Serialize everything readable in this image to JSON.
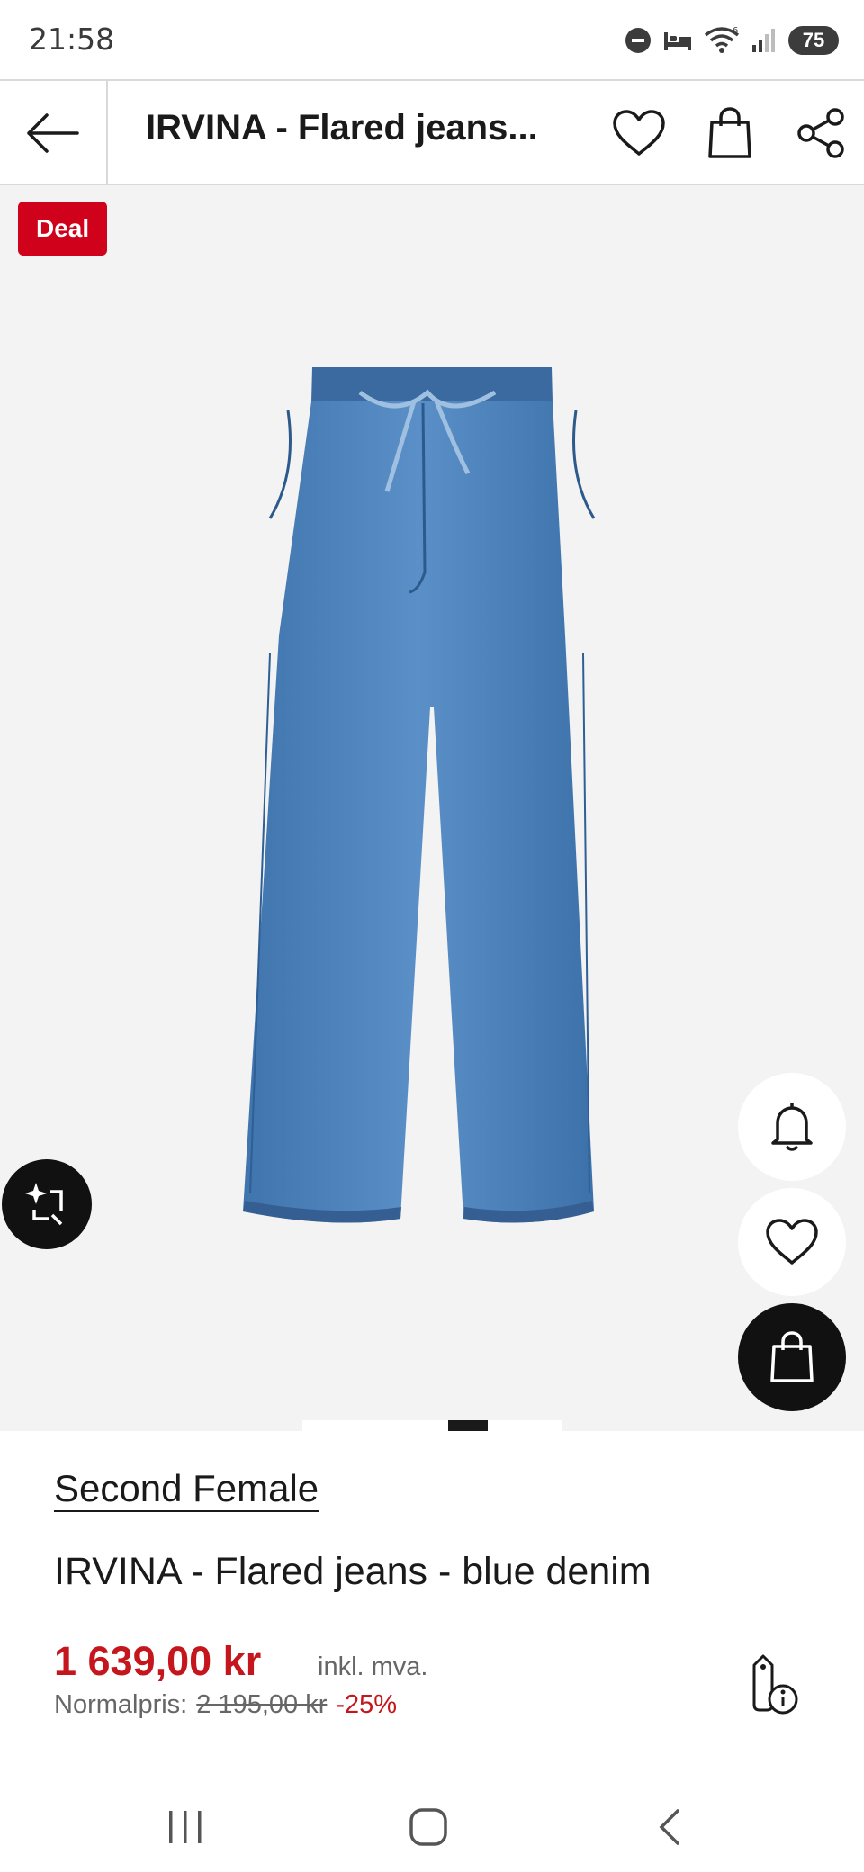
{
  "status_bar": {
    "time": "21:58",
    "battery": "75",
    "wifi_badge": "6"
  },
  "header": {
    "title": "IRVINA - Flared jeans..."
  },
  "gallery": {
    "badge": "Deal",
    "image_alt": "blue denim flared jeans",
    "pager_count": 5,
    "pager_active": 1
  },
  "product": {
    "brand": "Second Female",
    "name": "IRVINA - Flared jeans - blue denim",
    "price": "1 639,00 kr",
    "price_note": "inkl. mva.",
    "normal_label": "Normalpris:",
    "normal_price": "2 195,00 kr",
    "discount": "-25%"
  },
  "colors": {
    "accent_red": "#c4161c",
    "badge_red": "#d0021b",
    "denim": "#4a7fb8"
  },
  "icons": [
    "back-arrow-icon",
    "heart-icon",
    "bag-icon",
    "share-icon",
    "bell-icon",
    "sparkle-crop-icon",
    "price-tag-info-icon"
  ]
}
